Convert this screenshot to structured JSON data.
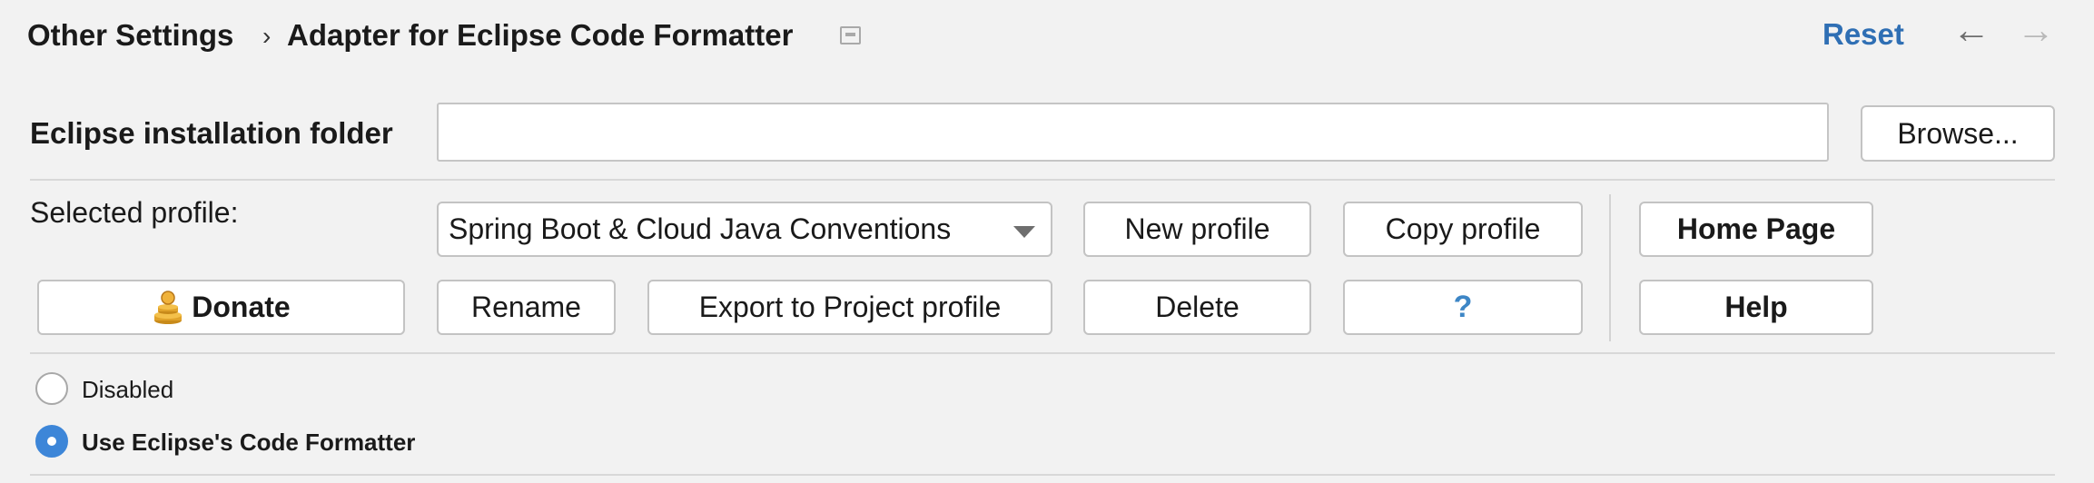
{
  "header": {
    "breadcrumb": [
      "Other Settings",
      "Adapter for Eclipse Code Formatter"
    ],
    "separator": "›",
    "reset_label": "Reset",
    "back_icon": "←",
    "forward_icon": "→"
  },
  "install": {
    "label": "Eclipse installation folder",
    "value": "",
    "browse_label": "Browse..."
  },
  "profile": {
    "label": "Selected profile:",
    "selected": "Spring Boot & Cloud Java Conventions",
    "buttons": {
      "new": "New profile",
      "copy": "Copy profile",
      "home": "Home Page",
      "donate": "Donate",
      "rename": "Rename",
      "export": "Export to Project profile",
      "delete": "Delete",
      "question": "?",
      "help": "Help"
    }
  },
  "mode": {
    "options": [
      {
        "label": "Disabled",
        "checked": false
      },
      {
        "label": "Use Eclipse's Code Formatter",
        "checked": true
      }
    ]
  },
  "colors": {
    "accent": "#3d86d8",
    "link": "#2f6fb4",
    "background": "#f2f2f2"
  }
}
